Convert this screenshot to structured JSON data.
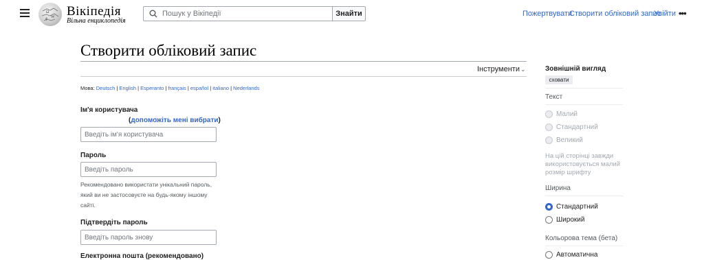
{
  "header": {
    "menu_icon": "hamburger-menu-icon",
    "logo_icon": "wikipedia-globe-logo",
    "wordmark": "Вікіпедія",
    "tagline": "Вільна енциклопедія",
    "search": {
      "placeholder": "Пошук у Вікіпедії",
      "button": "Знайти"
    },
    "links": {
      "donate": "Пожертвувати",
      "create_account": "Створити обліковий запис",
      "login": "Увійти"
    },
    "more": "•••"
  },
  "page": {
    "title": "Створити обліковий запис",
    "tools": "Інструменти",
    "languages": {
      "prefix": "Мова:",
      "items": [
        "Deutsch",
        "English",
        "Esperanto",
        "français",
        "español",
        "italiano",
        "Nederlands"
      ],
      "separator": " | "
    },
    "form": {
      "username_label": "Ім'я користувача",
      "help_text": "допоможіть мені вибрати",
      "username_placeholder": "Введіть ім'я користувача",
      "password_label": "Пароль",
      "password_placeholder": "Введіть пароль",
      "password_hint": "Рекомендовано використати унікальний пароль, який ви не застосовуєте на будь-якому іншому сайті.",
      "confirm_label": "Підтвердіть пароль",
      "confirm_placeholder": "Введіть пароль знову",
      "email_label": "Електронна пошта (рекомендовано)"
    }
  },
  "sidebar": {
    "heading": "Зовнішній вигляд",
    "hide": "сховати",
    "text_section": "Текст",
    "text_options": [
      "Малий",
      "Стандартний",
      "Великий"
    ],
    "text_note": "На цій сторінці завжди використовується малий розмір шрифту",
    "width_section": "Ширина",
    "width_options": [
      "Стандартний",
      "Широкий"
    ],
    "width_selected": "Стандартний",
    "color_section": "Кольорова тема (бета)",
    "color_options": [
      "Автоматична"
    ]
  },
  "colors": {
    "link": "#3366cc",
    "accent_radio": "#3366cc",
    "text": "#202122"
  }
}
